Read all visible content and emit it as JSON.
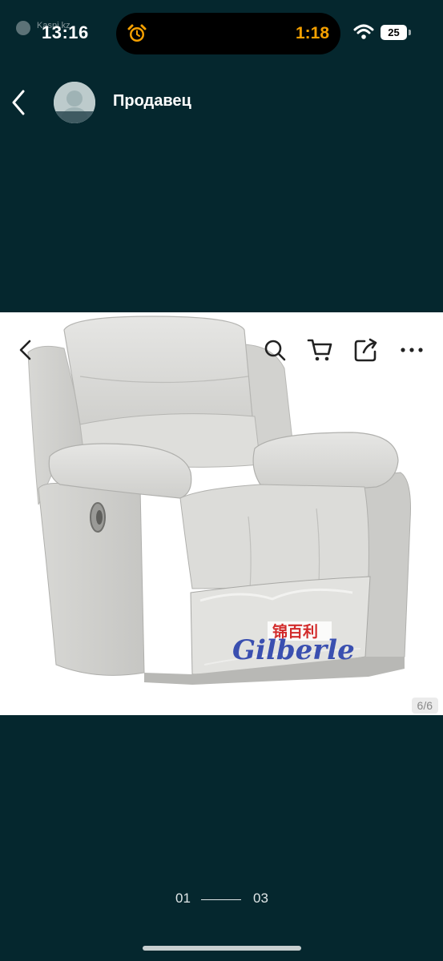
{
  "status_bar": {
    "time": "13:16",
    "carrier": "Kaspi.kz",
    "island_time": "1:18",
    "battery_level": "25",
    "icons": [
      "carrier-icon",
      "alarm-clock-icon",
      "wifi-icon",
      "battery-icon"
    ]
  },
  "header": {
    "back_icon": "chevron-left-icon",
    "seller_label": "Продавец"
  },
  "viewer": {
    "toolbar_icons": [
      "chevron-left-icon",
      "search-icon",
      "cart-icon",
      "share-icon",
      "more-icon"
    ],
    "image_counter": "6/6",
    "product_brand": "Gilberle",
    "product_brand_cn": "锦百利"
  },
  "pager": {
    "current": "01",
    "total": "03"
  },
  "colors": {
    "background": "#05272e",
    "island_accent": "#f5a000",
    "brand_text": "#3a4fb0",
    "brand_cn_text": "#d22a2a"
  }
}
